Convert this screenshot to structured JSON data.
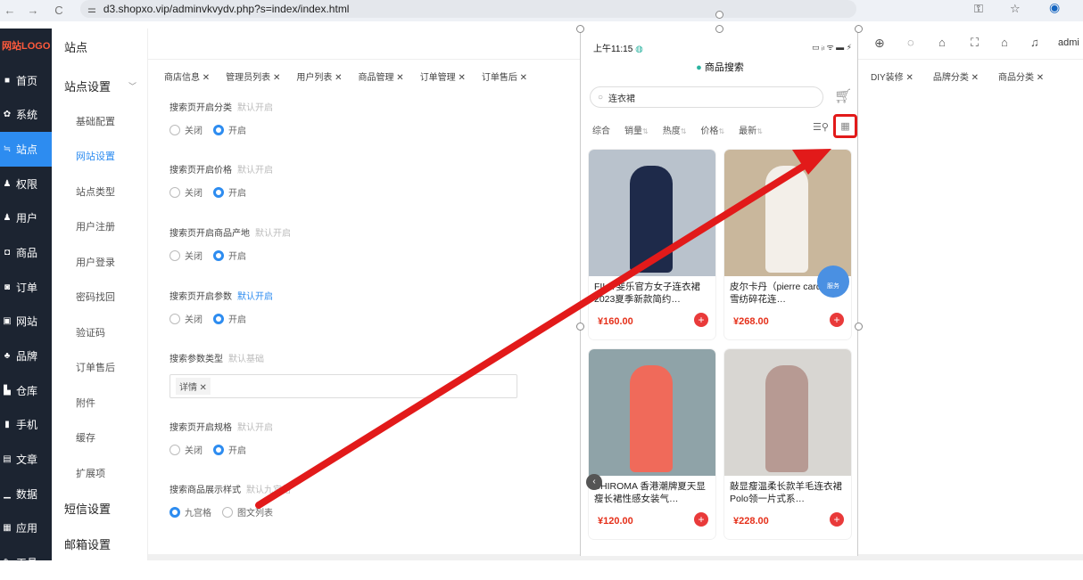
{
  "browser": {
    "url": "d3.shopxo.vip/adminvkvydv.php?s=index/index.html",
    "nav": [
      "←",
      "→",
      "C"
    ],
    "account_label": "admi"
  },
  "sidebar": {
    "logo": "网站LOGO",
    "items": [
      {
        "icon": "home-icon",
        "glyph": "■",
        "label": "首页"
      },
      {
        "icon": "gear-icon",
        "glyph": "✿",
        "label": "系统"
      },
      {
        "icon": "sliders-icon",
        "glyph": "≒",
        "label": "站点",
        "active": true
      },
      {
        "icon": "user-shield-icon",
        "glyph": "♟",
        "label": "权限"
      },
      {
        "icon": "user-icon",
        "glyph": "♟",
        "label": "用户"
      },
      {
        "icon": "bag-icon",
        "glyph": "◘",
        "label": "商品"
      },
      {
        "icon": "order-icon",
        "glyph": "◙",
        "label": "订单"
      },
      {
        "icon": "monitor-icon",
        "glyph": "▣",
        "label": "网站"
      },
      {
        "icon": "brand-icon",
        "glyph": "♣",
        "label": "品牌"
      },
      {
        "icon": "warehouse-icon",
        "glyph": "▙",
        "label": "仓库"
      },
      {
        "icon": "phone-icon",
        "glyph": "▮",
        "label": "手机"
      },
      {
        "icon": "article-icon",
        "glyph": "▤",
        "label": "文章"
      },
      {
        "icon": "chart-icon",
        "glyph": "▁",
        "label": "数据"
      },
      {
        "icon": "apps-icon",
        "glyph": "▦",
        "label": "应用"
      },
      {
        "icon": "tool-icon",
        "glyph": "✎",
        "label": "工具"
      }
    ]
  },
  "subnav": {
    "title": "站点",
    "group1": "站点设置",
    "items": [
      "基础配置",
      "网站设置",
      "站点类型",
      "用户注册",
      "用户登录",
      "密码找回",
      "验证码",
      "订单售后",
      "附件",
      "缓存",
      "扩展项"
    ],
    "group2": "短信设置",
    "group3": "邮箱设置"
  },
  "tabs": [
    "商店信息 ✕",
    "管理员列表 ✕",
    "用户列表 ✕",
    "商品管理 ✕",
    "订单管理 ✕",
    "订单售后 ✕"
  ],
  "tabs_right": [
    "DIY装修 ✕",
    "品牌分类 ✕",
    "商品分类 ✕"
  ],
  "fields": [
    {
      "label": "搜索页开启分类",
      "default": "默认开启",
      "options": [
        "关闭",
        "开启"
      ],
      "selected": 1
    },
    {
      "label": "搜索页开启价格",
      "default": "默认开启",
      "options": [
        "关闭",
        "开启"
      ],
      "selected": 1
    },
    {
      "label": "搜索页开启商品产地",
      "default": "默认开启",
      "options": [
        "关闭",
        "开启"
      ],
      "selected": 1
    },
    {
      "label": "搜索页开启参数",
      "default": "默认开启",
      "options": [
        "关闭",
        "开启"
      ],
      "selected": 1
    },
    {
      "label": "搜索参数类型",
      "default": "默认基础",
      "tag": "详情 ✕"
    },
    {
      "label": "搜索页开启规格",
      "default": "默认开启",
      "options": [
        "关闭",
        "开启"
      ],
      "selected": 1
    },
    {
      "label": "搜索商品展示样式",
      "default": "默认九宫格",
      "options": [
        "九宫格",
        "图文列表"
      ],
      "selected": 0
    }
  ],
  "phone": {
    "time": "上午11:15",
    "status_right": "▭ ᵢₗ ᯤ ▬ ⚡",
    "title": "商品搜索",
    "search_value": "连衣裙",
    "sorts": [
      {
        "label": "综合"
      },
      {
        "label": "销量",
        "arrow": "⇅"
      },
      {
        "label": "热度",
        "arrow": "⇅"
      },
      {
        "label": "价格",
        "arrow": "⇅"
      },
      {
        "label": "最新",
        "arrow": "⇅"
      }
    ],
    "service": "服务",
    "products": [
      {
        "title": "FILA 斐乐官方女子连衣裙2023夏季新款简约…",
        "price": "¥160.00",
        "bg": "#b9c2cc",
        "fg": "#1e2a4a"
      },
      {
        "title": "皮尔卡丹（pierre cardin）雪纺碎花连…",
        "price": "¥268.00",
        "bg": "#c9b79c",
        "fg": "#f3efe9"
      },
      {
        "title": "SHIROMA 香港潮牌夏天显瘦长裙性感女装气…",
        "price": "¥120.00",
        "bg": "#8fa3a8",
        "fg": "#f06a5a"
      },
      {
        "title": "敲显瘦温柔长款羊毛连衣裙Polo领一片式系…",
        "price": "¥228.00",
        "bg": "#d8d6d2",
        "fg": "#b79a93"
      }
    ]
  },
  "colors": {
    "accent": "#2d8cf0",
    "annotation": "#e21a1a",
    "price": "#e5301a",
    "sidebar": "#1c2431"
  }
}
